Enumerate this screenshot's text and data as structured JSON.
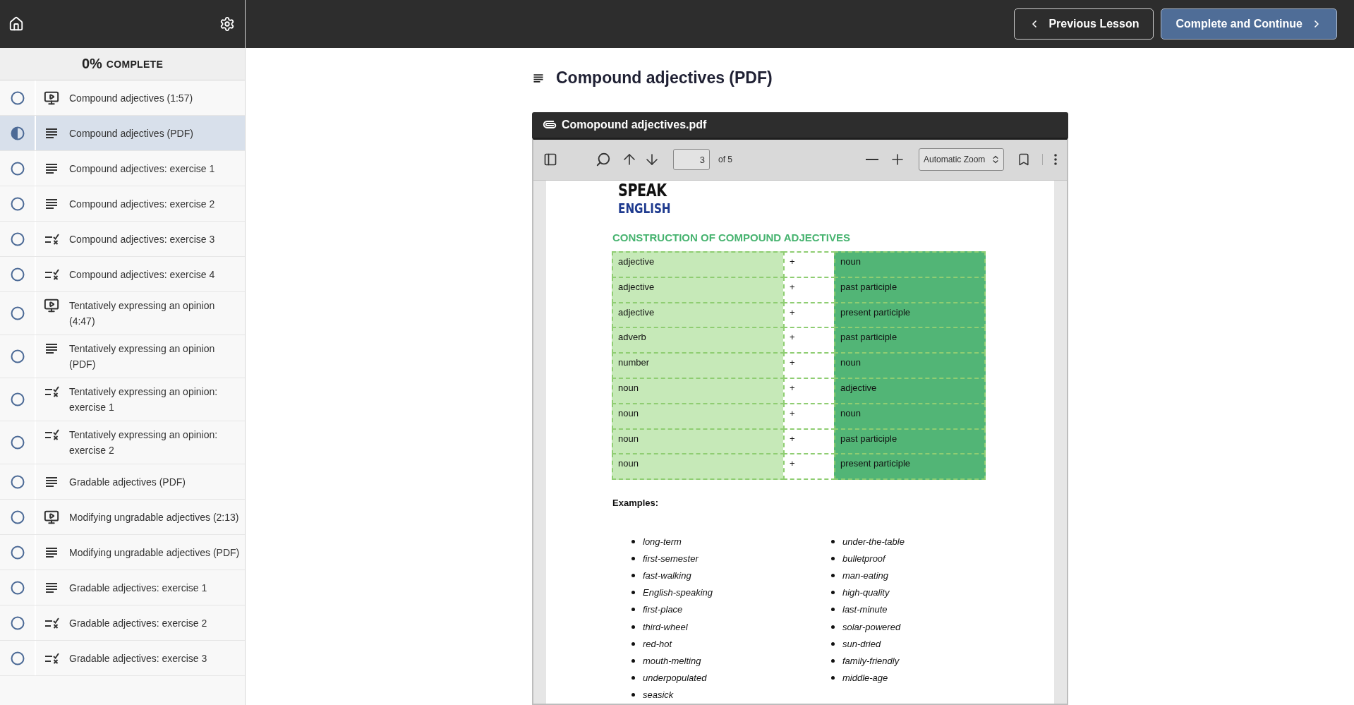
{
  "header": {
    "buttons": [
      {
        "label": "Previous Lesson",
        "kind": "back"
      },
      {
        "label": "Complete and Continue",
        "kind": "next"
      }
    ]
  },
  "sidebar": {
    "progress": {
      "value": "0%",
      "label": "COMPLETE"
    },
    "items": [
      {
        "title": "Compound adjectives (1:57)",
        "kind": "video",
        "in_progress": false,
        "selected": false
      },
      {
        "title": "Compound adjectives (PDF)",
        "kind": "text",
        "in_progress": true,
        "selected": true
      },
      {
        "title": "Compound adjectives: exercise 1",
        "kind": "text",
        "in_progress": false,
        "selected": false
      },
      {
        "title": "Compound adjectives: exercise 2",
        "kind": "text",
        "in_progress": false,
        "selected": false
      },
      {
        "title": "Compound adjectives: exercise 3",
        "kind": "quiz",
        "in_progress": false,
        "selected": false
      },
      {
        "title": "Compound adjectives: exercise 4",
        "kind": "quiz",
        "in_progress": false,
        "selected": false
      },
      {
        "title": "Tentatively expressing an opinion (4:47)",
        "kind": "video",
        "in_progress": false,
        "selected": false
      },
      {
        "title": "Tentatively expressing an opinion (PDF)",
        "kind": "text",
        "in_progress": false,
        "selected": false
      },
      {
        "title": "Tentatively expressing an opinion: exercise 1",
        "kind": "quiz",
        "in_progress": false,
        "selected": false
      },
      {
        "title": "Tentatively expressing an opinion: exercise 2",
        "kind": "quiz",
        "in_progress": false,
        "selected": false
      },
      {
        "title": "Gradable adjectives (PDF)",
        "kind": "text",
        "in_progress": false,
        "selected": false
      },
      {
        "title": "Modifying ungradable adjectives (2:13)",
        "kind": "video",
        "in_progress": false,
        "selected": false
      },
      {
        "title": "Modifying ungradable adjectives (PDF)",
        "kind": "text",
        "in_progress": false,
        "selected": false
      },
      {
        "title": "Gradable adjectives: exercise 1",
        "kind": "text",
        "in_progress": false,
        "selected": false
      },
      {
        "title": "Gradable adjectives: exercise 2",
        "kind": "quiz",
        "in_progress": false,
        "selected": false
      },
      {
        "title": "Gradable adjectives: exercise 3",
        "kind": "quiz",
        "in_progress": false,
        "selected": false
      }
    ]
  },
  "lesson": {
    "title": "Compound adjectives (PDF)",
    "attachment": {
      "filename": "Comopound adjectives.pdf",
      "viewer": {
        "page": "3",
        "page_count": "of 5",
        "zoom": "Automatic Zoom",
        "document": {
          "logo_top": "SPEAK",
          "logo_bottom": "ENGLISH",
          "heading": "CONSTRUCTION OF COMPOUND ADJECTIVES",
          "table": {
            "rows": [
              [
                "adjective",
                "+",
                "noun"
              ],
              [
                "adjective",
                "+",
                "past participle"
              ],
              [
                "adjective",
                "+",
                "present participle"
              ],
              [
                "adverb",
                "+",
                "past participle"
              ],
              [
                "number",
                "+",
                "noun"
              ],
              [
                "noun",
                "+",
                "adjective"
              ],
              [
                "noun",
                "+",
                "noun"
              ],
              [
                "noun",
                "+",
                "past participle"
              ],
              [
                "noun",
                "+",
                "present participle"
              ]
            ]
          },
          "examples_heading": "Examples:",
          "examples": [
            [
              "long-term",
              "first-semester",
              "fast-walking",
              "English-speaking",
              "first-place",
              "third-wheel",
              "red-hot",
              "mouth-melting",
              "underpopulated",
              "seasick"
            ],
            [
              "under-the-table",
              "bulletproof",
              "man-eating",
              "high-quality",
              "last-minute",
              "solar-powered",
              "sun-dried",
              "family-friendly",
              "middle-age"
            ]
          ]
        }
      }
    }
  }
}
